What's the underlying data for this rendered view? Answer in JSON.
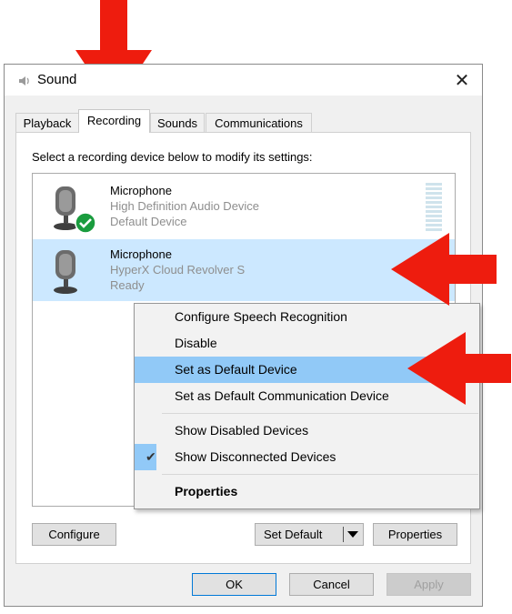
{
  "window": {
    "title": "Sound",
    "close_glyph": "✕"
  },
  "tabs": [
    {
      "label": "Playback",
      "active": false
    },
    {
      "label": "Recording",
      "active": true
    },
    {
      "label": "Sounds",
      "active": false
    },
    {
      "label": "Communications",
      "active": false
    }
  ],
  "instructions": "Select a recording device below to modify its settings:",
  "devices": [
    {
      "name": "Microphone",
      "description": "High Definition Audio Device",
      "status": "Default Device",
      "is_default": true,
      "selected": false,
      "icon": "microphone-icon"
    },
    {
      "name": "Microphone",
      "description": "HyperX Cloud Revolver S",
      "status": "Ready",
      "is_default": false,
      "selected": true,
      "icon": "microphone-icon"
    }
  ],
  "context_menu": {
    "items": [
      {
        "label": "Configure Speech Recognition"
      },
      {
        "label": "Disable"
      },
      {
        "label": "Set as Default Device",
        "highlighted": true
      },
      {
        "label": "Set as Default Communication Device"
      },
      {
        "label": "Show Disabled Devices"
      },
      {
        "label": "Show Disconnected Devices",
        "checked": true
      },
      {
        "label": "Properties",
        "bold": true
      }
    ]
  },
  "buttons": {
    "configure": "Configure",
    "set_default": "Set Default",
    "properties": "Properties",
    "ok": "OK",
    "cancel": "Cancel",
    "apply": "Apply"
  },
  "colors": {
    "selection": "#cce8ff",
    "menu_highlight": "#91c9f7",
    "annotation_arrow": "#ee1c0e",
    "default_badge": "#1a9c3e"
  }
}
